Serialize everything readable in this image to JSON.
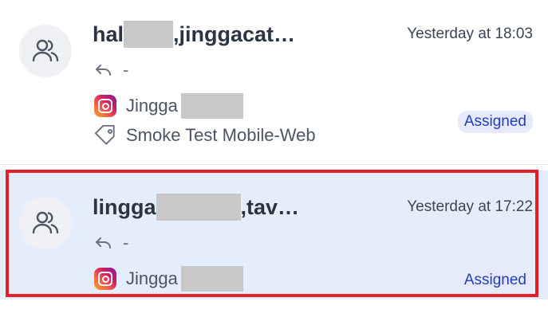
{
  "conversations": [
    {
      "title_prefix": "hal",
      "title_suffix": ",jinggacat…",
      "time": "Yesterday at 18:03",
      "last_message": "-",
      "channel_name": "Jingga",
      "tag": "Smoke Test Mobile-Web",
      "status": "Assigned"
    },
    {
      "title_prefix": "lingga",
      "title_suffix": ",tav…",
      "time": "Yesterday at 17:22",
      "last_message": "-",
      "channel_name": "Jingga",
      "status": "Assigned"
    }
  ],
  "icons": {
    "avatar": "group-users-icon",
    "reply": "reply-arrow-icon",
    "channel": "instagram-icon",
    "tag": "tag-icon"
  },
  "colors": {
    "selected_background": "#e4edfb",
    "highlight_border": "#e5202a",
    "badge_text": "#1f3fbf",
    "badge_background": "#e6eafb"
  }
}
